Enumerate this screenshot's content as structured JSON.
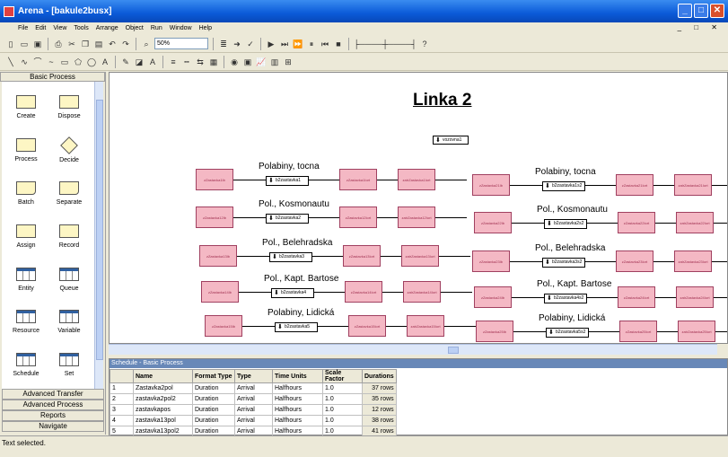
{
  "window": {
    "title": "Arena - [bakule2busx]"
  },
  "menu": [
    "File",
    "Edit",
    "View",
    "Tools",
    "Arrange",
    "Object",
    "Run",
    "Window",
    "Help"
  ],
  "toolbar": {
    "zoom": "50%"
  },
  "panel": {
    "title": "Basic Process",
    "modules": [
      "Create",
      "Dispose",
      "Process",
      "Decide",
      "Batch",
      "Separate",
      "Assign",
      "Record",
      "Entity",
      "Queue",
      "Resource",
      "Variable",
      "Schedule",
      "Set"
    ],
    "sections": [
      "Advanced Transfer",
      "Advanced Process",
      "Reports",
      "Navigate"
    ]
  },
  "canvas": {
    "heading": "Linka 2",
    "top_station": "vozovna1",
    "left_stations": [
      {
        "label": "Polabiny, tocna",
        "route": "b2zastavka1",
        "left": "zZastavka1Ib",
        "mid": "zZastavka1Iort",
        "right": "zatrZastavka1Iort"
      },
      {
        "label": "Pol., Kosmonautu",
        "route": "b2zastavka2",
        "left": "zZastavka12Ib",
        "mid": "zZastavka12Iort",
        "right": "zatrZastavka12Iort"
      },
      {
        "label": "Pol., Belehradska",
        "route": "b2zastavka3",
        "left": "zZastavka13Ib",
        "mid": "zZastavka13Iort",
        "right": "zatrZastavka13Iort"
      },
      {
        "label": "Pol., Kapt. Bartose",
        "route": "b2zastavka4",
        "left": "zZastavka14Ib",
        "mid": "zZastavka14Iort",
        "right": "zatrZastavka14Iort"
      },
      {
        "label": "Polabiny, Lidická",
        "route": "b2zastavka5",
        "left": "zZastavka15Ib",
        "mid": "zZastavka15Iort",
        "right": "zatrZastavka15Iort"
      }
    ],
    "right_stations": [
      {
        "label": "Polabiny, tocna",
        "route": "b2zastavka1s2",
        "left": "zZastavka21Ib",
        "mid": "zZastavka21Iort",
        "right": "zatrZastavka21Iort"
      },
      {
        "label": "Pol., Kosmonautu",
        "route": "b2zastavka2s2",
        "left": "zZastavka22Ib",
        "mid": "zZastavka22Iort",
        "right": "zatrZastavka22Iort"
      },
      {
        "label": "Pol., Belehradska",
        "route": "b2zastavka3s2",
        "left": "zZastavka23Ib",
        "mid": "zZastavka23Iort",
        "right": "zatrZastavka23Iort"
      },
      {
        "label": "Pol., Kapt. Bartose",
        "route": "b2zastavka4s2",
        "left": "zZastavka24Ib",
        "mid": "zZastavka24Iort",
        "right": "zatrZastavka24Iort"
      },
      {
        "label": "Polabiny, Lidická",
        "route": "b2zastavka5s2",
        "left": "zZastavka25Ib",
        "mid": "zZastavka25Iort",
        "right": "zatrZastavka25Iort"
      }
    ]
  },
  "schedule": {
    "title": "Schedule - Basic Process",
    "columns": [
      "",
      "Name",
      "Format Type",
      "Type",
      "Time Units",
      "Scale Factor",
      "Durations"
    ],
    "rows": [
      [
        "1",
        "Zastavka2pol",
        "Duration",
        "Arrival",
        "Halfhours",
        "1.0",
        "37 rows"
      ],
      [
        "2",
        "zastavka2pol2",
        "Duration",
        "Arrival",
        "Halfhours",
        "1.0",
        "35 rows"
      ],
      [
        "3",
        "zastavkapos",
        "Duration",
        "Arrival",
        "Halfhours",
        "1.0",
        "12 rows"
      ],
      [
        "4",
        "zastavka13pol",
        "Duration",
        "Arrival",
        "Halfhours",
        "1.0",
        "38 rows"
      ],
      [
        "5",
        "zastavka13pol2",
        "Duration",
        "Arrival",
        "Halfhours",
        "1.0",
        "41 rows"
      ]
    ]
  },
  "status": {
    "text": "Text selected."
  }
}
